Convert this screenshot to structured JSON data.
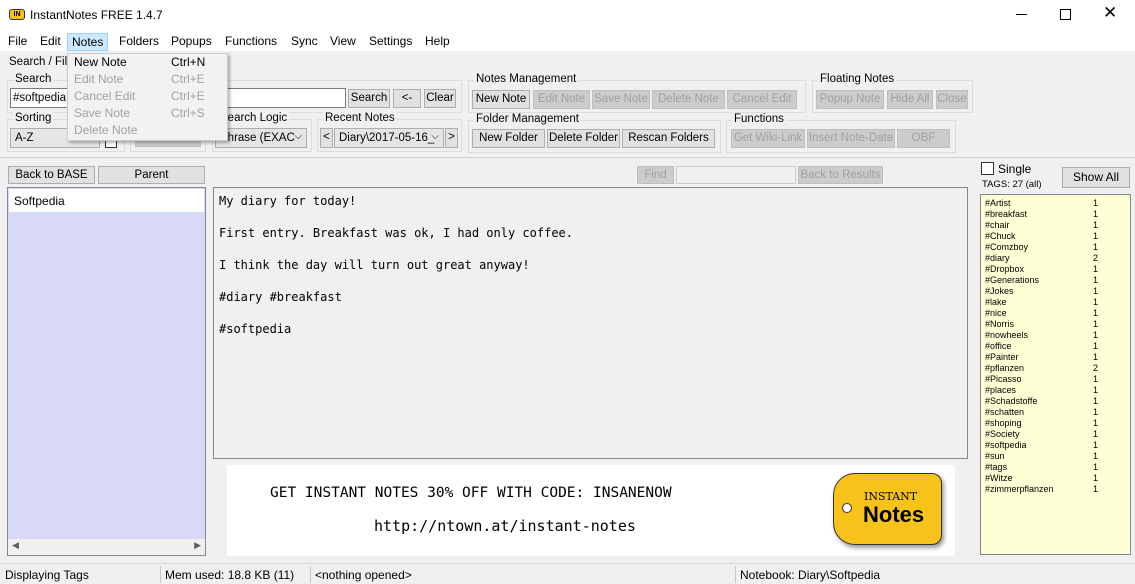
{
  "window": {
    "title": "InstantNotes FREE 1.4.7",
    "app_icon_text": "IN"
  },
  "menu": [
    "File",
    "Edit",
    "Notes",
    "Folders",
    "Popups",
    "Functions",
    "Sync",
    "View",
    "Settings",
    "Help"
  ],
  "notes_menu": [
    {
      "label": "New Note",
      "shortcut": "Ctrl+N",
      "enabled": true
    },
    {
      "label": "Edit Note",
      "shortcut": "Ctrl+E",
      "enabled": false
    },
    {
      "label": "Cancel Edit",
      "shortcut": "Ctrl+E",
      "enabled": false
    },
    {
      "label": "Save Note",
      "shortcut": "Ctrl+S",
      "enabled": false
    },
    {
      "label": "Delete Note",
      "shortcut": "",
      "enabled": false
    }
  ],
  "search_filter": {
    "tab_label": "Search / Filt",
    "search_group": "Search",
    "search_value": "#softpedia",
    "search_button": "Search",
    "back_button": "<-",
    "clear_button": "Clear",
    "sorting_group": "Sorting",
    "sorting_value": "A-Z",
    "search_logic_group": "Search Logic",
    "search_logic_value": "Phrase (EXAC",
    "recent_notes_group": "Recent Notes",
    "recent_notes_value": "Diary\\2017-05-16_",
    "prev": "<",
    "next": ">"
  },
  "notes_management": {
    "title": "Notes Management",
    "buttons": [
      {
        "label": "New Note",
        "enabled": true
      },
      {
        "label": "Edit Note",
        "enabled": false
      },
      {
        "label": "Save Note",
        "enabled": false
      },
      {
        "label": "Delete Note",
        "enabled": false
      },
      {
        "label": "Cancel Edit",
        "enabled": false
      }
    ]
  },
  "floating_notes": {
    "title": "Floating Notes",
    "buttons": [
      {
        "label": "Popup Note",
        "enabled": false
      },
      {
        "label": "Hide All",
        "enabled": false
      },
      {
        "label": "Close",
        "enabled": false
      }
    ]
  },
  "folder_management": {
    "title": "Folder Management",
    "buttons": [
      {
        "label": "New Folder",
        "enabled": true
      },
      {
        "label": "Delete Folder",
        "enabled": true
      },
      {
        "label": "Rescan Folders",
        "enabled": true
      }
    ]
  },
  "functions": {
    "title": "Functions",
    "buttons": [
      {
        "label": "Get Wiki-Link",
        "enabled": false
      },
      {
        "label": "Insert Note-Date",
        "enabled": false
      },
      {
        "label": "OBF",
        "enabled": false
      }
    ]
  },
  "left_panel": {
    "back_to_base": "Back to BASE",
    "parent": "Parent",
    "folders": [
      "Softpedia"
    ]
  },
  "find_bar": {
    "find": "Find",
    "find_value": "",
    "back_to_results": "Back to Results"
  },
  "note": {
    "lines": [
      "My diary for today!",
      "First entry. Breakfast was ok, I had only coffee.",
      "I think the day will turn out great anyway!",
      "#diary #breakfast",
      "#softpedia"
    ]
  },
  "banner": {
    "text": "GET INSTANT NOTES 30% OFF WITH CODE: INSANENOW",
    "url": "http://ntown.at/instant-notes",
    "logo_top": "INSTANT",
    "logo_bottom": "Notes"
  },
  "tags_panel": {
    "single_label": "Single",
    "single_checked": false,
    "show_all": "Show All",
    "count_label": "TAGS: 27 (all)",
    "tags": [
      [
        "#Artist",
        1
      ],
      [
        "#breakfast",
        1
      ],
      [
        "#chair",
        1
      ],
      [
        "#Chuck",
        1
      ],
      [
        "#Comzboy",
        1
      ],
      [
        "#diary",
        2
      ],
      [
        "#Dropbox",
        1
      ],
      [
        "#Generations",
        1
      ],
      [
        "#Jokes",
        1
      ],
      [
        "#lake",
        1
      ],
      [
        "#nice",
        1
      ],
      [
        "#Norris",
        1
      ],
      [
        "#nowheels",
        1
      ],
      [
        "#office",
        1
      ],
      [
        "#Painter",
        1
      ],
      [
        "#pflanzen",
        2
      ],
      [
        "#Picasso",
        1
      ],
      [
        "#places",
        1
      ],
      [
        "#Schadstoffe",
        1
      ],
      [
        "#schatten",
        1
      ],
      [
        "#shoping",
        1
      ],
      [
        "#Society",
        1
      ],
      [
        "#softpedia",
        1
      ],
      [
        "#sun",
        1
      ],
      [
        "#tags",
        1
      ],
      [
        "#Witze",
        1
      ],
      [
        "#zimmerpflanzen",
        1
      ]
    ]
  },
  "status": {
    "mode": "Displaying Tags",
    "mem": "Mem used: 18.8 KB (11)",
    "opened": "<nothing opened>",
    "notebook": "Notebook: Diary\\Softpedia"
  },
  "colors": {
    "folder_list_bg": "#d8d8f8",
    "tag_list_bg": "#ffffd6",
    "logo_yellow": "#f7c21a",
    "menu_highlight": "#cce8ff"
  }
}
